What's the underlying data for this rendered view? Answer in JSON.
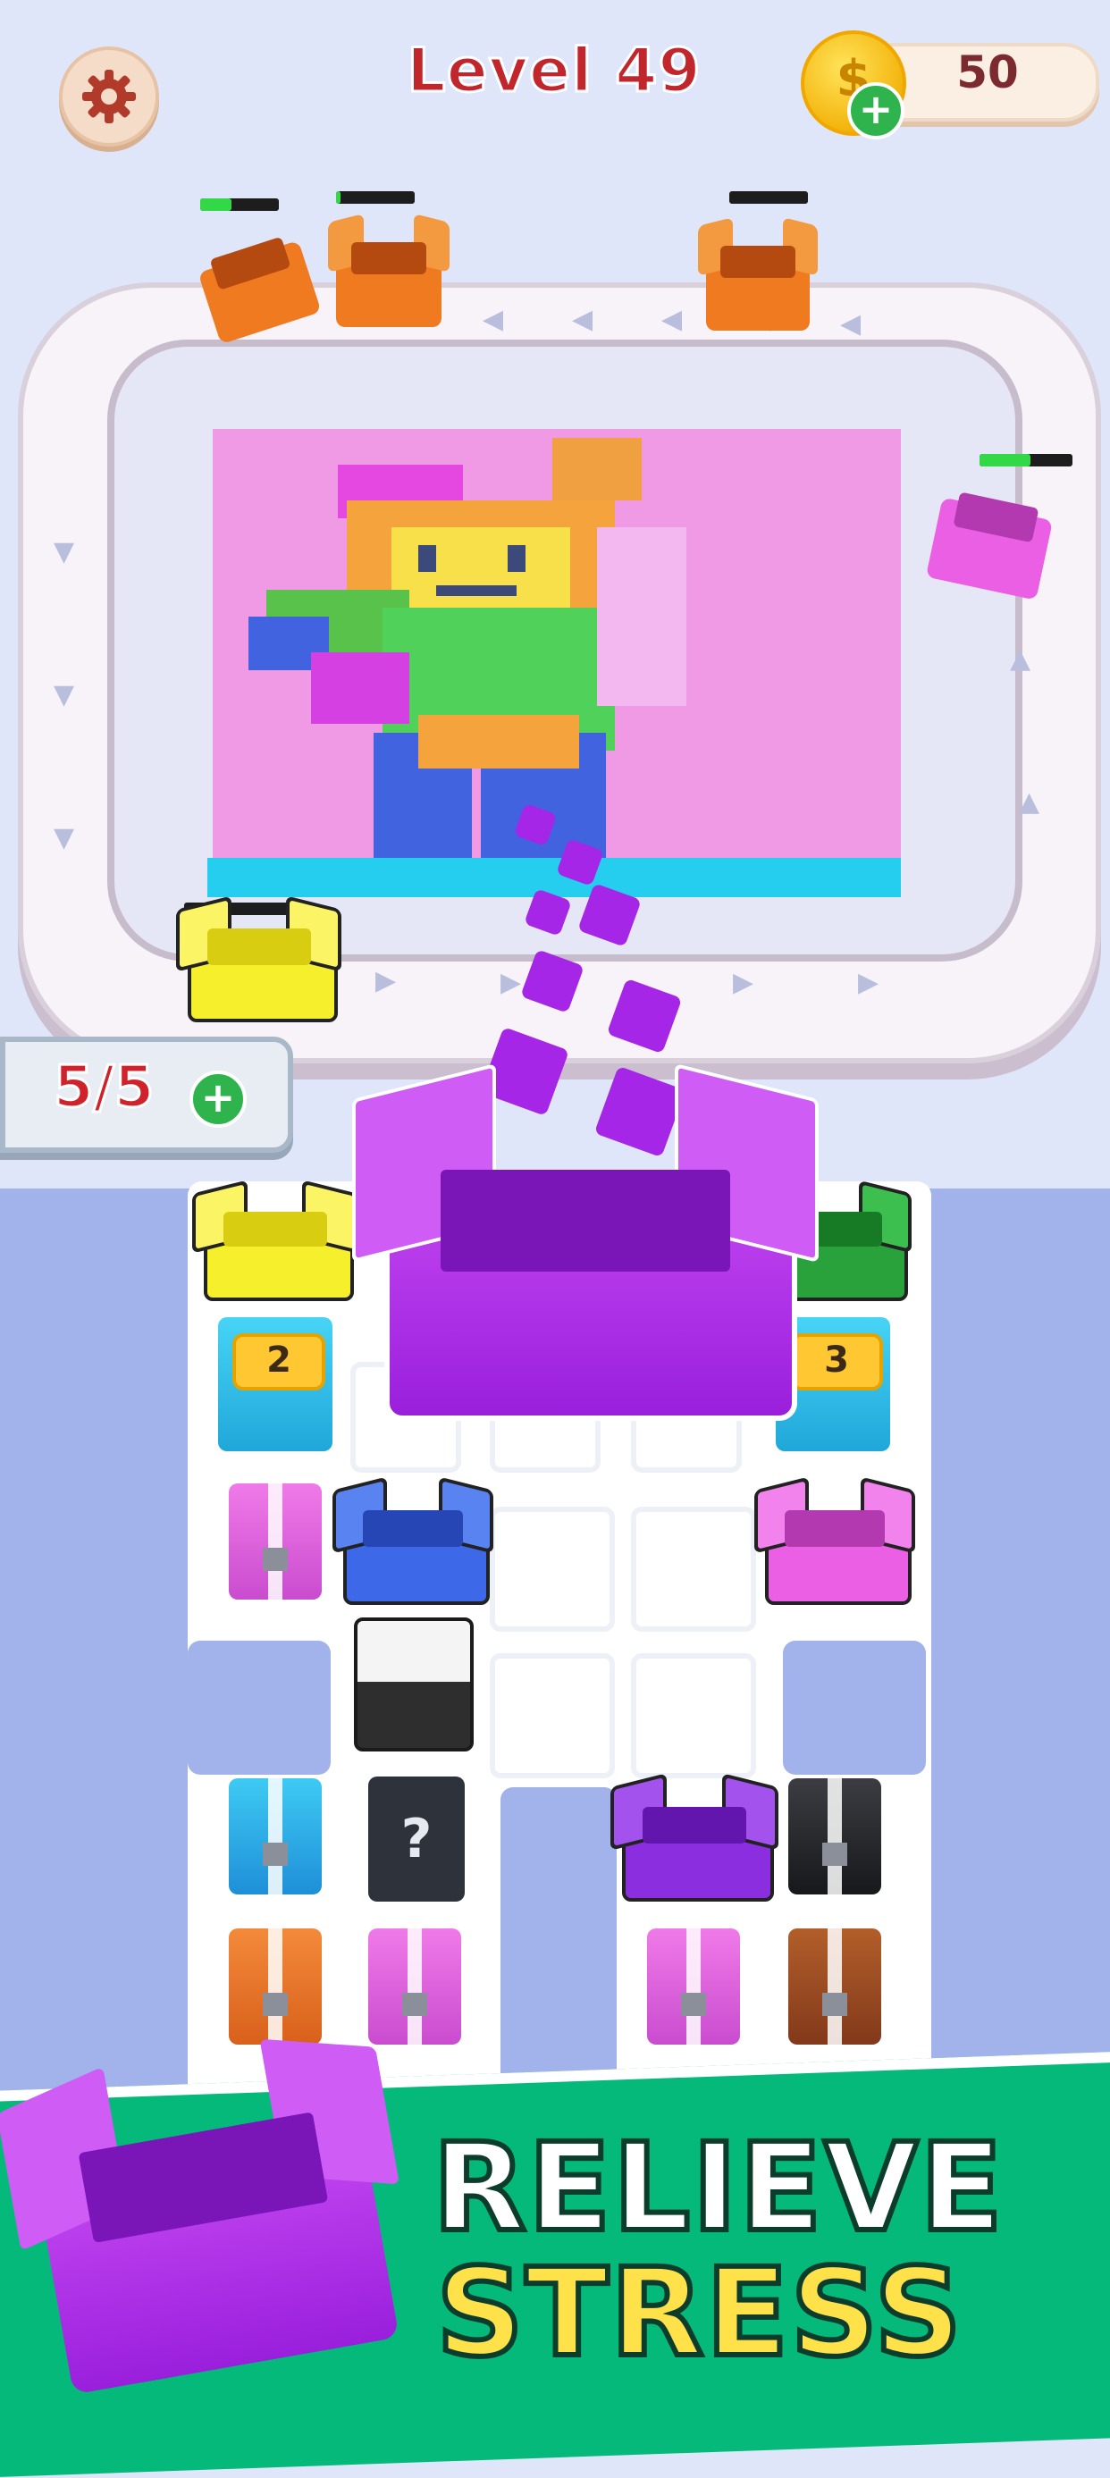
{
  "header": {
    "level_title": "Level 49",
    "coins": "50",
    "coin_symbol": "$"
  },
  "lives": {
    "text": "5/5"
  },
  "board": {
    "counters": [
      "2",
      "3"
    ],
    "mystery_marks": "?"
  },
  "banner": {
    "line1": "RELIEVE",
    "line2": "STRESS"
  },
  "colors": {
    "accent_red": "#c0262b",
    "banner_green": "#06be7c",
    "slogan_yellow": "#ffe14a",
    "main_box_purple": "#a526e6"
  },
  "icons": [
    "gear-icon",
    "coin-icon",
    "plus-icon"
  ]
}
